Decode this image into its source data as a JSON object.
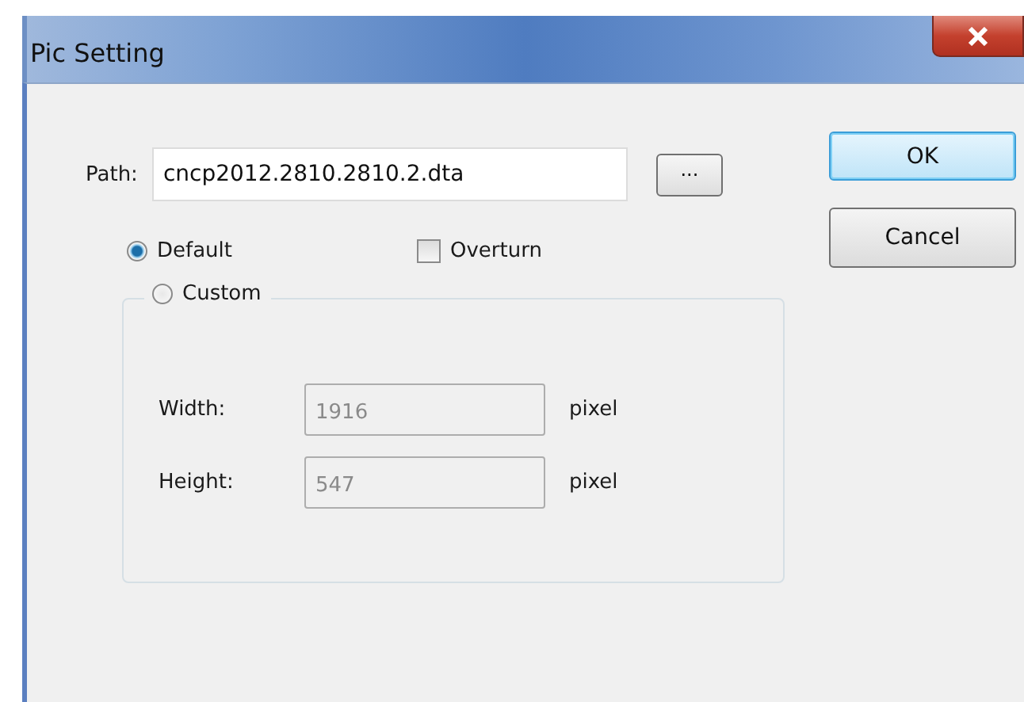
{
  "window": {
    "title": "Pic Setting"
  },
  "path": {
    "label": "Path:",
    "value": "cncp2012.2810.2810.2.dta",
    "browse": "..."
  },
  "options": [
    {
      "kind": "radio",
      "label": "Default",
      "selected": true
    },
    {
      "kind": "checkbox",
      "label": "Overturn",
      "checked": false
    }
  ],
  "custom": {
    "label": "Custom",
    "selected": false,
    "fields": [
      {
        "label": "Width:",
        "value": "1916",
        "unit": "pixel",
        "disabled": true
      },
      {
        "label": "Height:",
        "value": "547",
        "unit": "pixel",
        "disabled": true
      }
    ]
  },
  "buttons": [
    {
      "label": "OK",
      "default": true
    },
    {
      "label": "Cancel",
      "default": false
    }
  ]
}
